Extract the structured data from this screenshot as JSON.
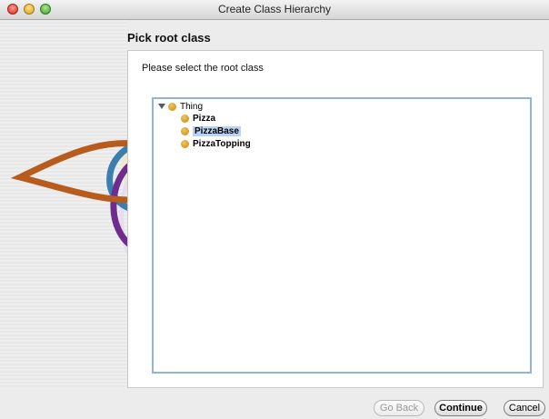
{
  "window": {
    "title": "Create Class Hierarchy"
  },
  "step": {
    "title": "Pick root class"
  },
  "instruction": "Please select the root class",
  "tree": {
    "root": {
      "label": "Thing",
      "expanded": true
    },
    "children": [
      {
        "label": "Pizza",
        "selected": false
      },
      {
        "label": "PizzaBase",
        "selected": true
      },
      {
        "label": "PizzaTopping",
        "selected": false
      }
    ]
  },
  "buttons": {
    "back": "Go Back",
    "continue": "Continue",
    "cancel": "Cancel"
  },
  "colors": {
    "class_dot": "#d6a021",
    "selection": "#b7d3f5",
    "tree_border": "#8fb3d9"
  },
  "icons": {
    "class": "class-dot-icon",
    "expand": "disclosure-triangle-down-icon"
  }
}
